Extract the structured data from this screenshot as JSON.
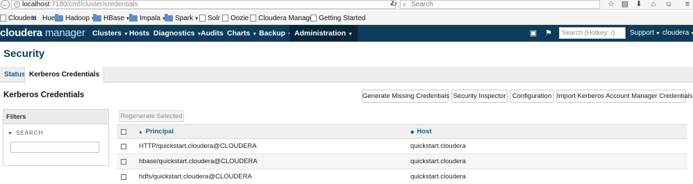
{
  "browser": {
    "url_host": "localhost",
    "url_path": ":7180/cmf/cluster/credentials",
    "search_placeholder": "Search",
    "toolbar_icons": [
      "star-icon",
      "clipboard-icon",
      "download-icon",
      "home-icon",
      "chat-icon",
      "menu-icon"
    ]
  },
  "bookmarks": [
    {
      "label": "Cloudera",
      "icon": "doc-icon",
      "dropdown": false
    },
    {
      "label": "Hue",
      "icon": "hue-icon",
      "dropdown": false
    },
    {
      "label": "Hadoop",
      "icon": "folder-icon",
      "dropdown": true
    },
    {
      "label": "HBase",
      "icon": "folder-icon",
      "dropdown": true
    },
    {
      "label": "Impala",
      "icon": "folder-icon",
      "dropdown": true
    },
    {
      "label": "Spark",
      "icon": "folder-icon",
      "dropdown": true
    },
    {
      "label": "Solr",
      "icon": "doc-icon",
      "dropdown": false
    },
    {
      "label": "Oozie",
      "icon": "doc-icon",
      "dropdown": false
    },
    {
      "label": "Cloudera Manager",
      "icon": "doc-icon",
      "dropdown": false
    },
    {
      "label": "Getting Started",
      "icon": "doc-icon",
      "dropdown": false
    }
  ],
  "nav": {
    "logo_part1": "cloudera",
    "logo_part2": "manager",
    "items": [
      {
        "label": "Clusters",
        "dropdown": true
      },
      {
        "label": "Hosts",
        "dropdown": false
      },
      {
        "label": "Diagnostics",
        "dropdown": true
      },
      {
        "label": "Audits",
        "dropdown": false
      },
      {
        "label": "Charts",
        "dropdown": true
      },
      {
        "label": "Backup",
        "dropdown": true
      },
      {
        "label": "Administration",
        "dropdown": true,
        "active": true
      }
    ],
    "search_placeholder": "Search (Hotkey: /)",
    "support_label": "Support",
    "user_label": "cloudera"
  },
  "page": {
    "title": "Security",
    "tabs": [
      {
        "label": "Status",
        "active": false
      },
      {
        "label": "Kerberos Credentials",
        "active": true
      }
    ],
    "section_title": "Kerberos Credentials",
    "actions": [
      "Generate Missing Credentials",
      "Security Inspector",
      "Configuration",
      "Import Kerberos Account Manager Credentials"
    ]
  },
  "filters": {
    "title": "Filters",
    "search_label": "SEARCH",
    "search_value": ""
  },
  "table": {
    "regenerate_label": "Regenerate Selected",
    "columns": [
      "Principal",
      "Host"
    ],
    "rows": [
      {
        "principal": "HTTP/quickstart.cloudera@CLOUDERA",
        "host": "quickstart.cloudera"
      },
      {
        "principal": "hbase/quickstart.cloudera@CLOUDERA",
        "host": "quickstart.cloudera"
      },
      {
        "principal": "hdfs/quickstart.cloudera@CLOUDERA",
        "host": "quickstart.cloudera"
      }
    ]
  },
  "colors": {
    "nav_bg": "#0d3c5a",
    "nav_active_bg": "#06263b",
    "link": "#1f5b86",
    "title": "#0d3c5a"
  }
}
